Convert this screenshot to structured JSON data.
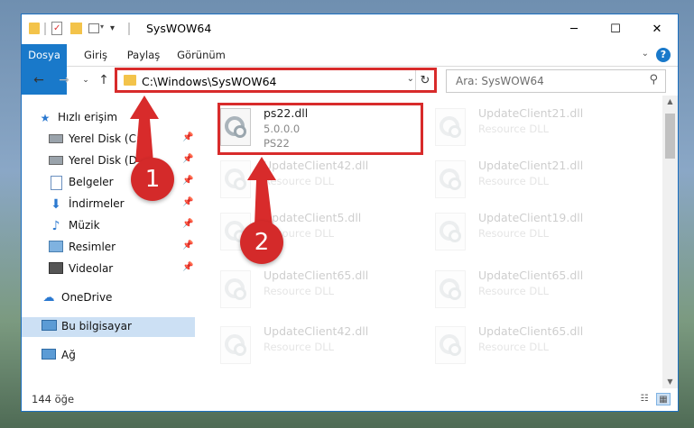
{
  "window": {
    "title": "SysWOW64",
    "controls": {
      "minimize": "─",
      "maximize": "☐",
      "close": "✕"
    }
  },
  "ribbon": {
    "tabs": [
      "Dosya",
      "Giriş",
      "Paylaş",
      "Görünüm"
    ],
    "help": "?"
  },
  "nav": {
    "address": "C:\\Windows\\SysWOW64",
    "search_placeholder": "Ara: SysWOW64"
  },
  "sidebar": {
    "items": [
      {
        "label": "Hızlı erişim",
        "icon": "star-icon",
        "pinned": false
      },
      {
        "label": "Yerel Disk (C:)",
        "icon": "drive-icon",
        "pinned": true
      },
      {
        "label": "Yerel Disk (D:)",
        "icon": "drive-icon",
        "pinned": true
      },
      {
        "label": "Belgeler",
        "icon": "documents-icon",
        "pinned": true
      },
      {
        "label": "İndirmeler",
        "icon": "download-icon",
        "pinned": true
      },
      {
        "label": "Müzik",
        "icon": "music-icon",
        "pinned": true
      },
      {
        "label": "Resimler",
        "icon": "pictures-icon",
        "pinned": true
      },
      {
        "label": "Videolar",
        "icon": "videos-icon",
        "pinned": true
      },
      {
        "label": "OneDrive",
        "icon": "cloud-icon",
        "pinned": false
      },
      {
        "label": "Bu bilgisayar",
        "icon": "computer-icon",
        "pinned": false
      },
      {
        "label": "Ağ",
        "icon": "network-icon",
        "pinned": false
      }
    ]
  },
  "files": {
    "highlighted": {
      "name": "ps22.dll",
      "version": "5.0.0.0",
      "description": "PS22"
    },
    "background": [
      {
        "name": "UpdateClient21.dll",
        "desc": "Resource DLL"
      },
      {
        "name": "UpdateClient42.dll",
        "desc": "Resource DLL"
      },
      {
        "name": "UpdateClient21.dll",
        "desc": "Resource DLL"
      },
      {
        "name": "UpdateClient5.dll",
        "desc": "Resource DLL"
      },
      {
        "name": "UpdateClient19.dll",
        "desc": "Resource DLL"
      },
      {
        "name": "UpdateClient65.dll",
        "desc": "Resource DLL"
      },
      {
        "name": "UpdateClient65.dll",
        "desc": "Resource DLL"
      },
      {
        "name": "UpdateClient42.dll",
        "desc": "Resource DLL"
      },
      {
        "name": "UpdateClient65.dll",
        "desc": "Resource DLL"
      }
    ]
  },
  "status": {
    "count": "144 öğe"
  },
  "annotations": {
    "badge1": "1",
    "badge2": "2",
    "color": "#d82b2b"
  }
}
